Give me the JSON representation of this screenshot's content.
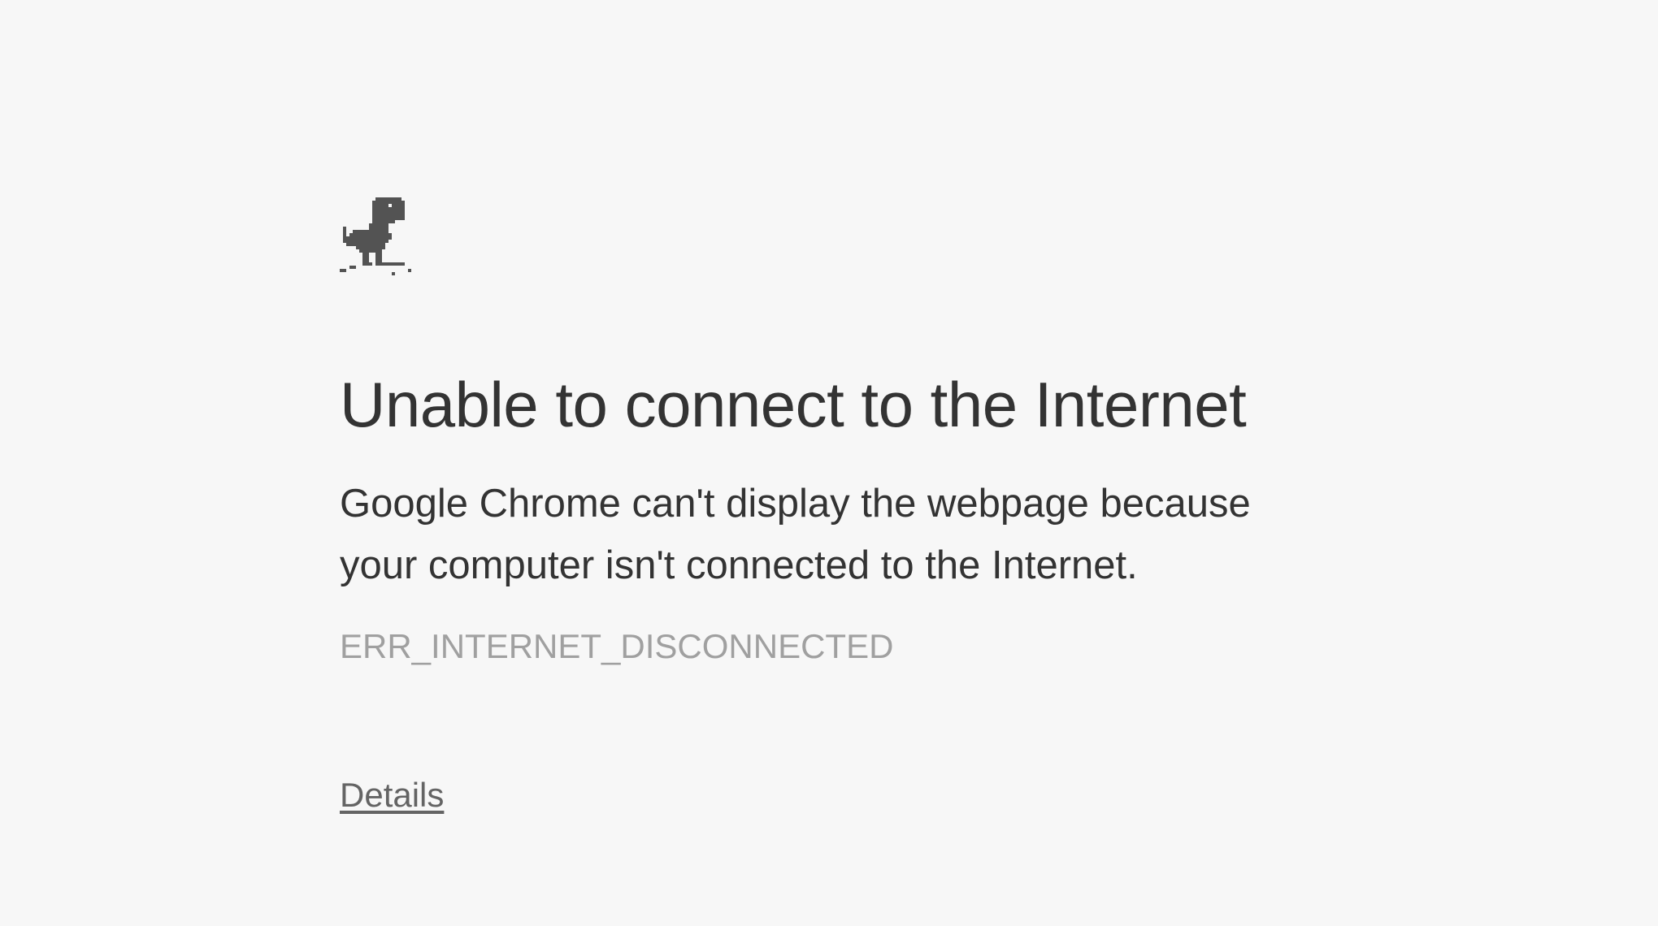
{
  "page": {
    "icon": "offline-dino-icon",
    "title": "Unable to connect to the Internet",
    "message": "Google Chrome can't display the webpage because your computer isn't connected to the Internet.",
    "error_code": "ERR_INTERNET_DISCONNECTED",
    "details_link": "Details"
  },
  "colors": {
    "background": "#f7f7f7",
    "heading": "#333333",
    "error_code": "#a0a0a0",
    "link": "#646464",
    "icon": "#535353"
  }
}
